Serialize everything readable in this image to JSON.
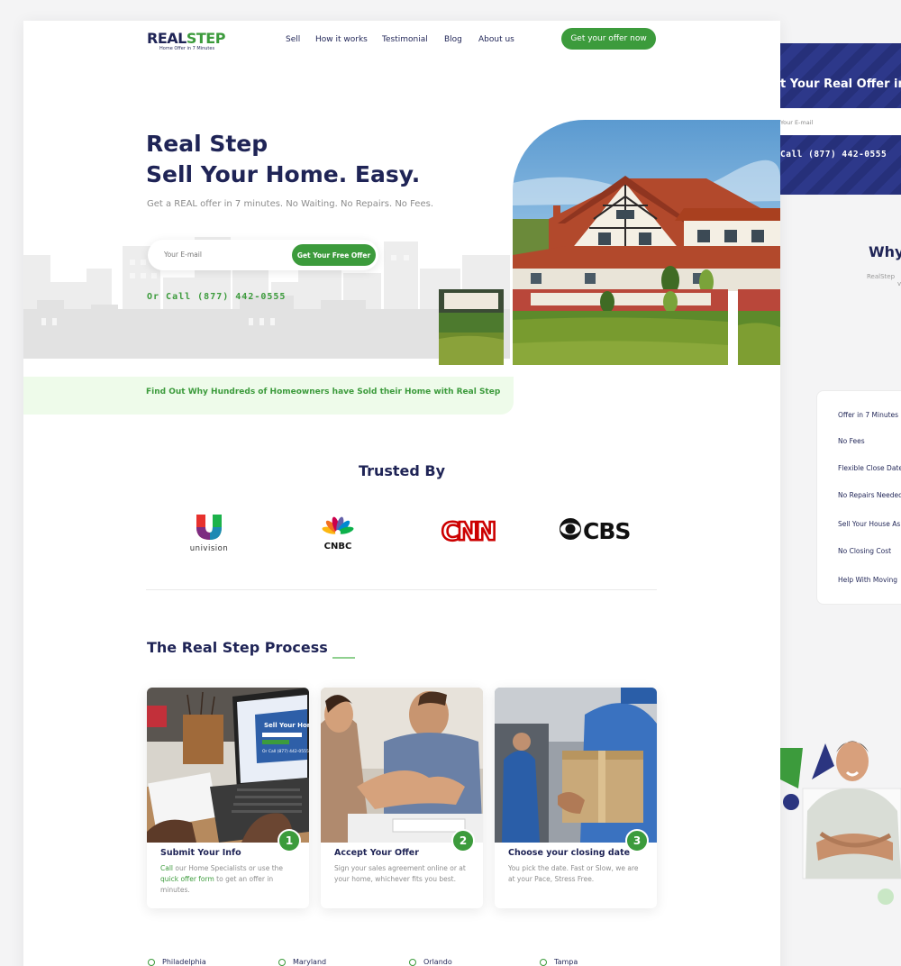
{
  "logo": {
    "part1": "REAL",
    "part2": "STEP",
    "tagline": "Home Offer in 7 Minutes"
  },
  "nav": {
    "items": [
      "Sell",
      "How it works",
      "Testimonial",
      "Blog",
      "About us"
    ],
    "cta": "Get your offer now"
  },
  "hero": {
    "title_line1": "Real Step",
    "title_line2": "Sell Your Home. Easy.",
    "subtitle": "Get a REAL offer in 7 minutes. No Waiting. No Repairs. No Fees.",
    "email_placeholder": "Your E-mail",
    "submit_label": "Get Your Free Offer",
    "call": "Or Call (877) 442-0555"
  },
  "find_out": "Find Out Why Hundreds of Homeowners have Sold their Home with Real Step",
  "trusted": {
    "heading": "Trusted By",
    "logos": [
      "univision",
      "CNBC",
      "CNN",
      "CBS"
    ]
  },
  "process": {
    "heading": "The Real Step Process",
    "steps": [
      {
        "num": "1",
        "title": "Submit Your Info",
        "desc_a": "Call",
        "desc_b": " our Home Specialists or use the ",
        "desc_c": "quick offer form",
        "desc_d": " to get an offer in minutes.",
        "screen_title": "Sell Your Home",
        "screen_call": "Or Call (877) 442-0555"
      },
      {
        "num": "2",
        "title": "Accept Your Offer",
        "desc": "Sign your sales agreement online or  at your home,  whichever fits you best."
      },
      {
        "num": "3",
        "title": "Choose your closing date",
        "desc": "You pick the date. Fast or Slow, we are at your Pace, Stress Free."
      }
    ]
  },
  "cities": [
    "Philadelphia",
    "Maryland",
    "Orlando",
    "Tampa"
  ],
  "right_panel": {
    "banner_title": "t Your Real Offer in",
    "email_placeholder": "Your E-mail",
    "call": "Call (877) 442-0555",
    "why_title": "Why",
    "why_sub": "RealStep",
    "why_sub2": "v",
    "benefits": [
      "Offer in 7 Minutes",
      "No Fees",
      "Flexible Close Date",
      "No Repairs Needed",
      "Sell Your House As",
      "No Closing Cost",
      "Help With Moving"
    ]
  },
  "colors": {
    "brand_green": "#3c9b3c",
    "brand_navy": "#1f2456",
    "light_green": "#eefbea"
  }
}
